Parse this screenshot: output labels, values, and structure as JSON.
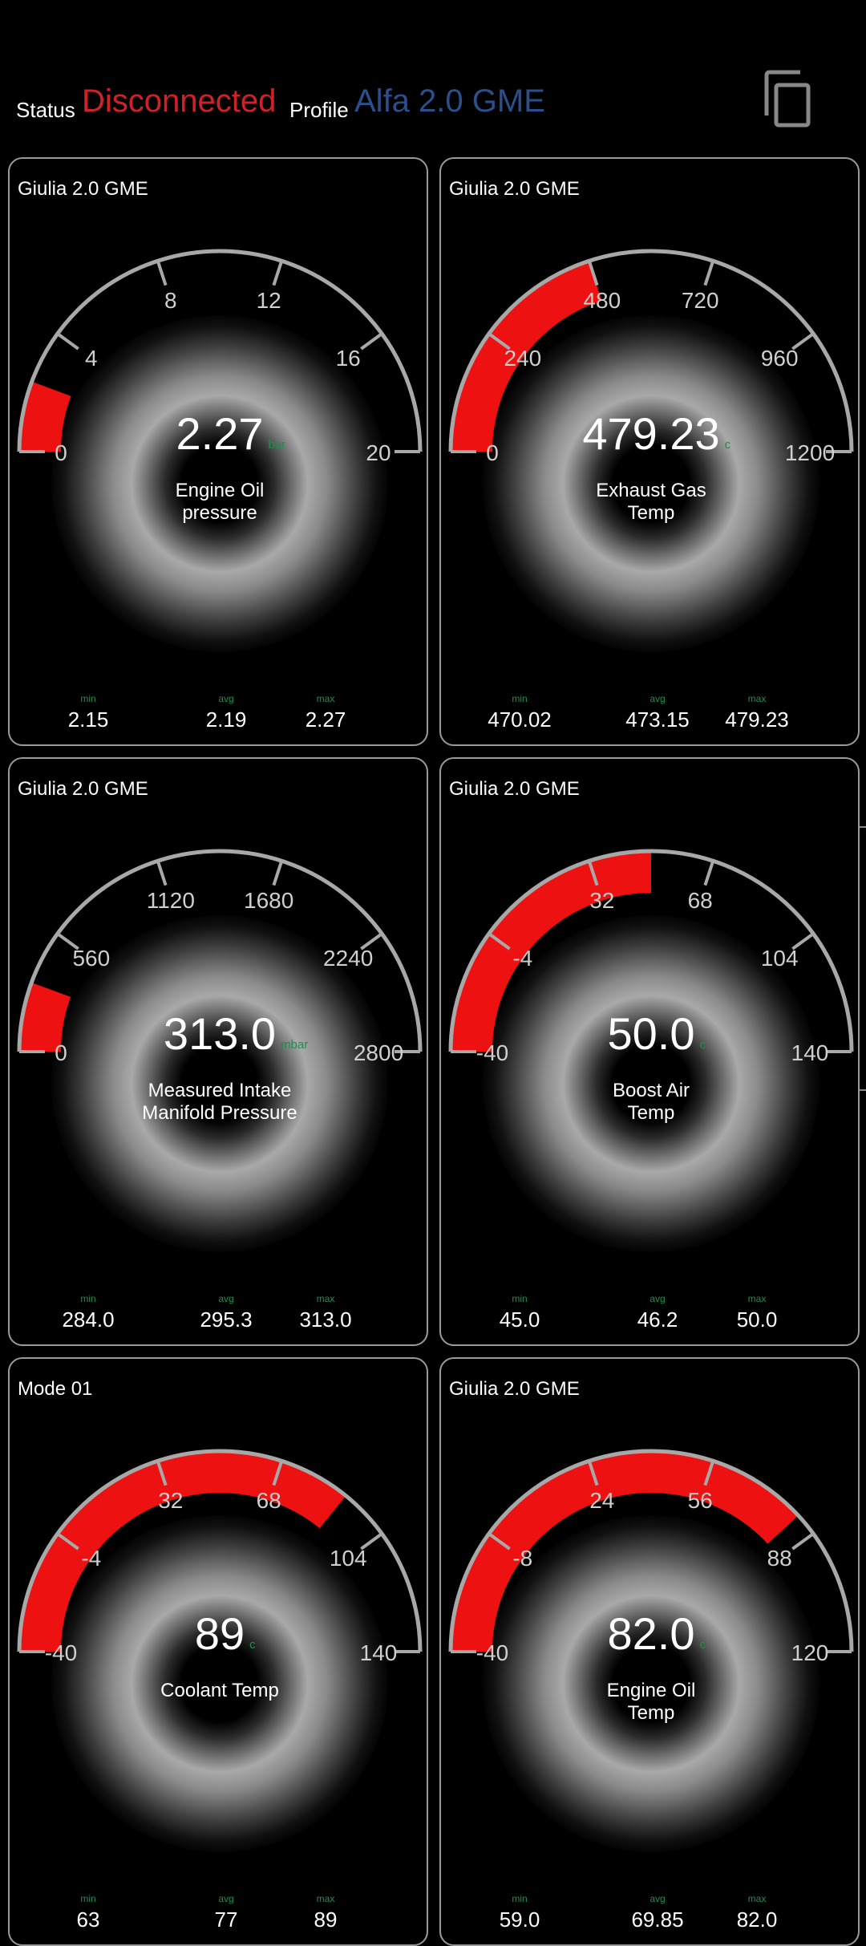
{
  "header": {
    "status_label": "Status",
    "status_value": "Disconnected",
    "profile_label": "Profile",
    "profile_value": "Alfa 2.0 GME",
    "status_color": "#d0202a",
    "profile_color": "#2b4f8c",
    "copy_icon": "copy-icon"
  },
  "colors": {
    "needle_fill": "#ee1111",
    "arc": "#a8a8a8",
    "unit": "#1f8f4a"
  },
  "gauges": [
    {
      "title": "Giulia 2.0 GME",
      "name_lines": [
        "Engine Oil",
        "pressure"
      ],
      "value": "2.27",
      "unit": "bar",
      "min": 0,
      "max": 20,
      "ticks": [
        "0",
        "4",
        "8",
        "12",
        "16",
        "20"
      ],
      "reading": 2.27,
      "stats": {
        "min_label": "min",
        "avg_label": "avg",
        "max_label": "max",
        "min": "2.15",
        "avg": "2.19",
        "max": "2.27"
      }
    },
    {
      "title": "Giulia 2.0 GME",
      "name_lines": [
        "Exhaust Gas",
        "Temp"
      ],
      "value": "479.23",
      "unit": "c",
      "min": 0,
      "max": 1200,
      "ticks": [
        "0",
        "240",
        "480",
        "720",
        "960",
        "1200"
      ],
      "reading": 479.23,
      "stats": {
        "min_label": "min",
        "avg_label": "avg",
        "max_label": "max",
        "min": "470.02",
        "avg": "473.15",
        "max": "479.23"
      }
    },
    {
      "title": "Giulia 2.0 GME",
      "name_lines": [
        "Measured Intake",
        "Manifold Pressure"
      ],
      "value": "313.0",
      "unit": "mbar",
      "min": 0,
      "max": 2800,
      "ticks": [
        "0",
        "560",
        "1120",
        "1680",
        "2240",
        "2800"
      ],
      "reading": 313.0,
      "stats": {
        "min_label": "min",
        "avg_label": "avg",
        "max_label": "max",
        "min": "284.0",
        "avg": "295.3",
        "max": "313.0"
      }
    },
    {
      "title": "Giulia 2.0 GME",
      "name_lines": [
        "Boost Air",
        "Temp"
      ],
      "value": "50.0",
      "unit": "c",
      "min": -40,
      "max": 140,
      "ticks": [
        "-40",
        "-4",
        "32",
        "68",
        "104",
        "140"
      ],
      "reading": 50.0,
      "stats": {
        "min_label": "min",
        "avg_label": "avg",
        "max_label": "max",
        "min": "45.0",
        "avg": "46.2",
        "max": "50.0"
      }
    },
    {
      "title": "Mode 01",
      "name_lines": [
        "Coolant Temp"
      ],
      "value": "89",
      "unit": "c",
      "min": -40,
      "max": 140,
      "ticks": [
        "-40",
        "-4",
        "32",
        "68",
        "104",
        "140"
      ],
      "reading": 89,
      "stats": {
        "min_label": "min",
        "avg_label": "avg",
        "max_label": "max",
        "min": "63",
        "avg": "77",
        "max": "89"
      }
    },
    {
      "title": "Giulia 2.0 GME",
      "name_lines": [
        "Engine Oil",
        "Temp"
      ],
      "value": "82.0",
      "unit": "c",
      "min": -40,
      "max": 120,
      "ticks": [
        "-40",
        "-8",
        "24",
        "56",
        "88",
        "120"
      ],
      "reading": 82.0,
      "stats": {
        "min_label": "min",
        "avg_label": "avg",
        "max_label": "max",
        "min": "59.0",
        "avg": "69.85",
        "max": "82.0"
      }
    }
  ]
}
